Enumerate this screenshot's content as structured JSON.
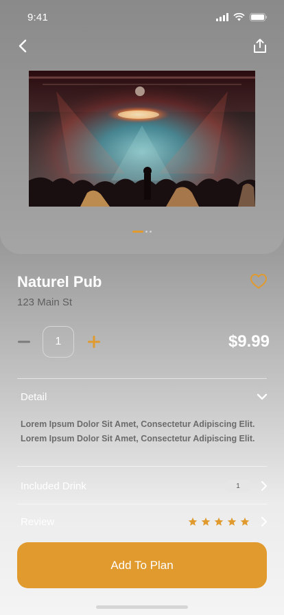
{
  "status_bar": {
    "time": "9:41"
  },
  "venue": {
    "name": "Naturel Pub",
    "address": "123 Main St",
    "price": "$9.99",
    "quantity": "1",
    "favorited": false
  },
  "carousel": {
    "active_index": 0,
    "total": 3
  },
  "detail": {
    "label": "Detail",
    "description": "Lorem Ipsum Dolor Sit Amet, Consectetur Adipiscing Elit. Lorem Ipsum Dolor Sit Amet, Consectetur Adipiscing Elit.",
    "expanded": true
  },
  "included_drink": {
    "label": "Included Drink",
    "count": "1"
  },
  "review": {
    "label": "Review",
    "rating": 5,
    "max_rating": 5
  },
  "cta": {
    "label": "Add To Plan"
  },
  "colors": {
    "accent": "#e09a2e",
    "muted_text": "#5e5e5e"
  },
  "icons": {
    "back": "chevron-left-icon",
    "share": "share-icon",
    "favorite": "heart-outline-icon",
    "expand": "chevron-down-icon",
    "row_arrow": "chevron-right-icon"
  }
}
